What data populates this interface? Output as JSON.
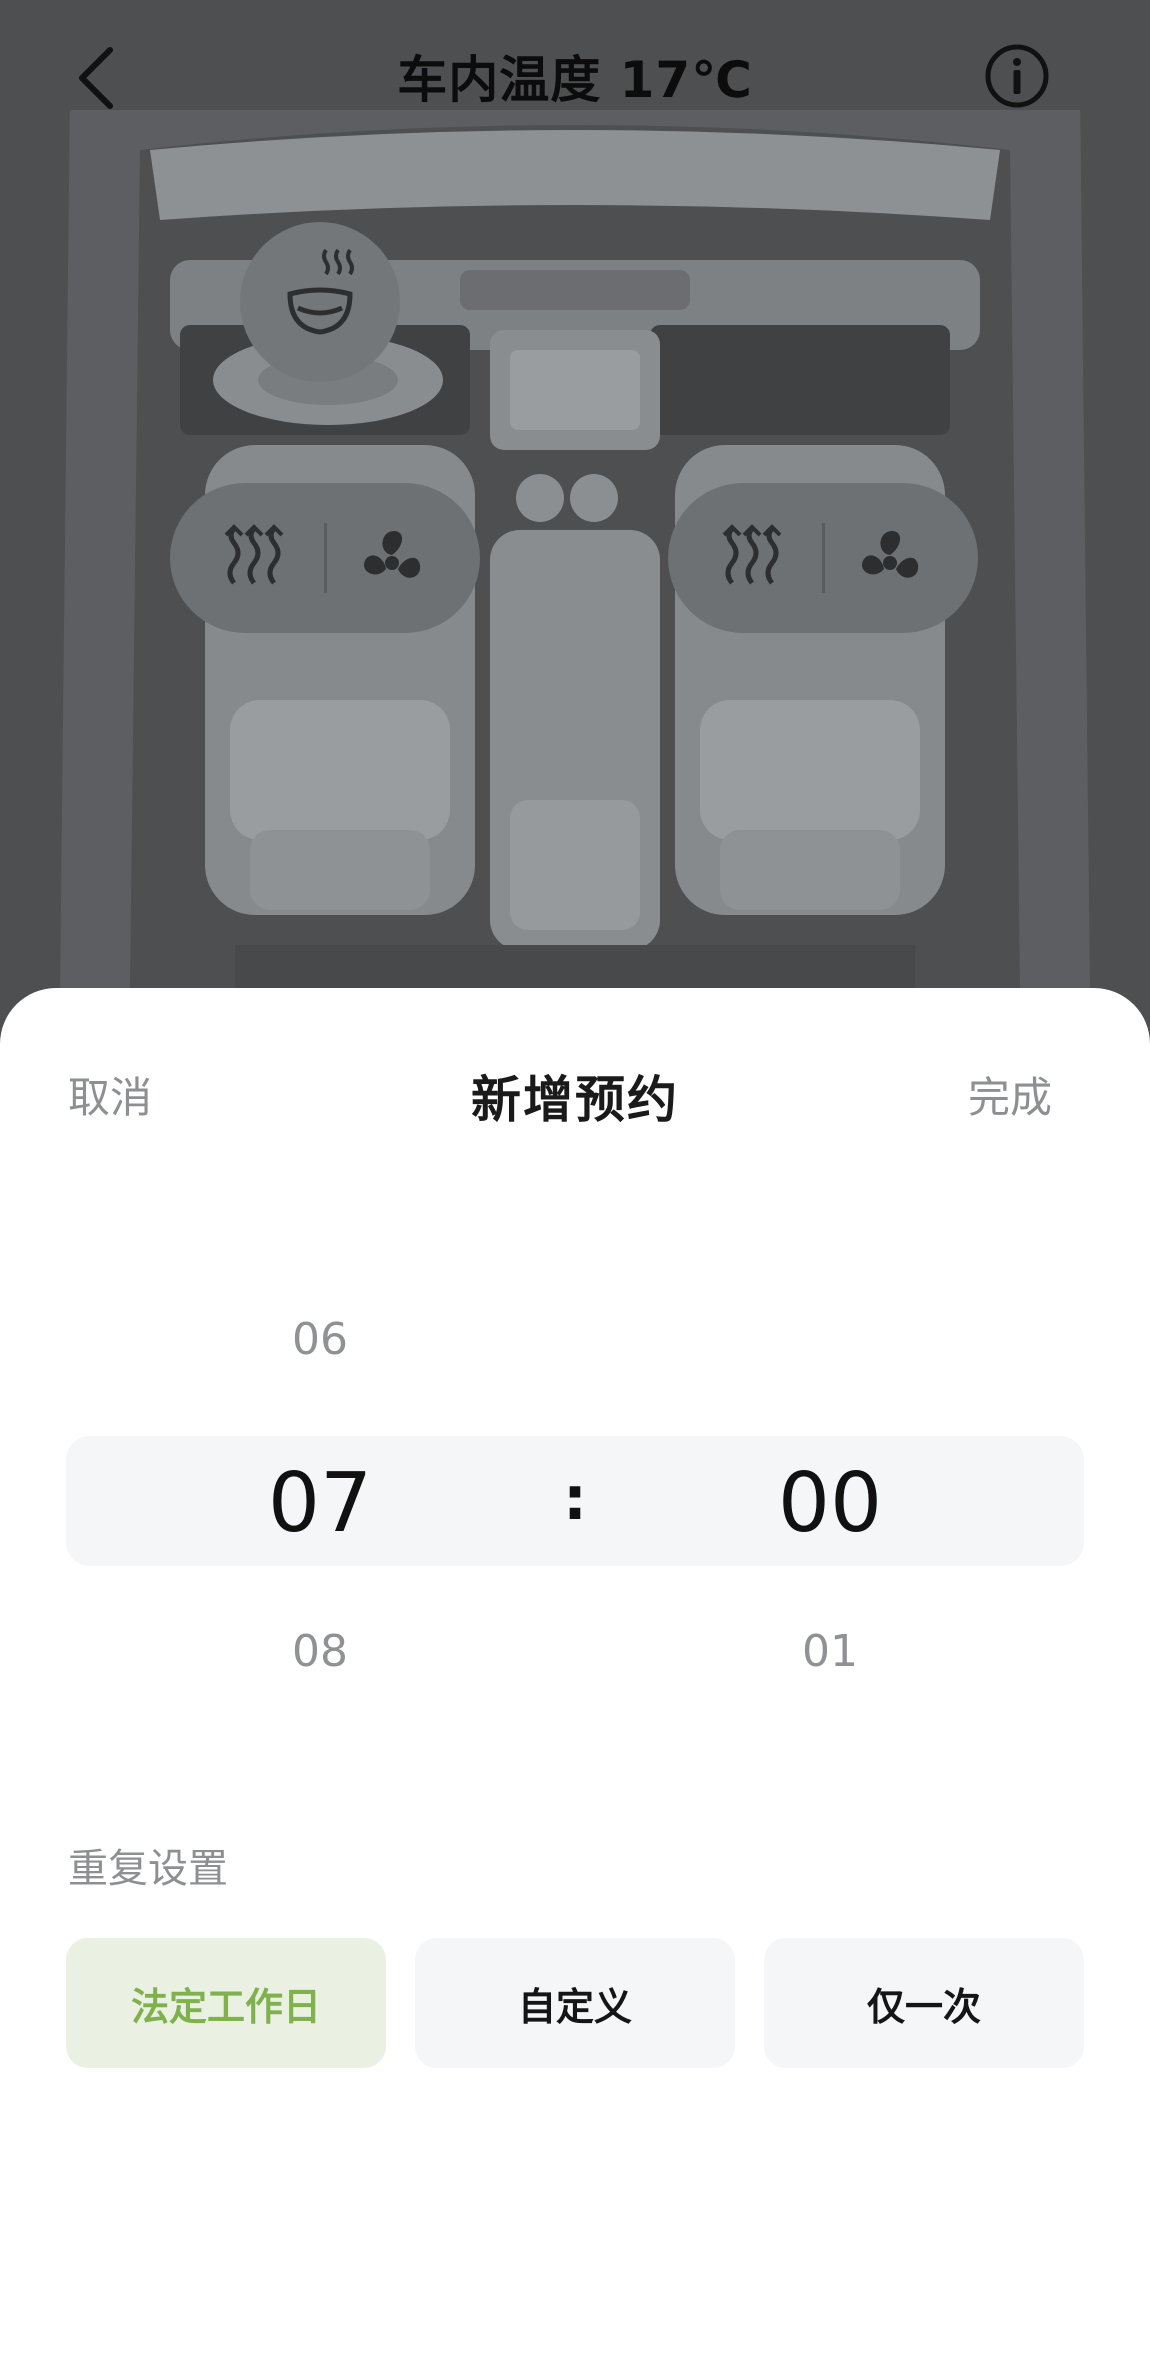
{
  "header": {
    "title": "车内温度 17℃",
    "icons": {
      "back": "chevron-left-icon",
      "info": "info-circle-icon"
    }
  },
  "car_controls": {
    "steering_heat_icon": "steering-wheel-heat-icon",
    "left_seat": {
      "heat_icon": "seat-heat-icon",
      "vent_icon": "seat-fan-icon"
    },
    "right_seat": {
      "heat_icon": "seat-heat-icon",
      "vent_icon": "seat-fan-icon"
    }
  },
  "sheet": {
    "cancel_label": "取消",
    "title": "新增预约",
    "done_label": "完成",
    "time_picker": {
      "hour": {
        "prev": "06",
        "selected": "07",
        "next": "08"
      },
      "separator": ":",
      "minute": {
        "prev": "",
        "selected": "00",
        "next": "01"
      }
    },
    "repeat": {
      "label": "重复设置",
      "options": [
        {
          "label": "法定工作日",
          "selected": true
        },
        {
          "label": "自定义",
          "selected": false
        },
        {
          "label": "仅一次",
          "selected": false
        }
      ]
    }
  },
  "colors": {
    "overlay": "#4e4f51",
    "accent_green": "#7fb24c",
    "selected_bg": "#eaf1e3",
    "option_bg": "#f5f6f8",
    "muted_text": "#8d8f93"
  }
}
